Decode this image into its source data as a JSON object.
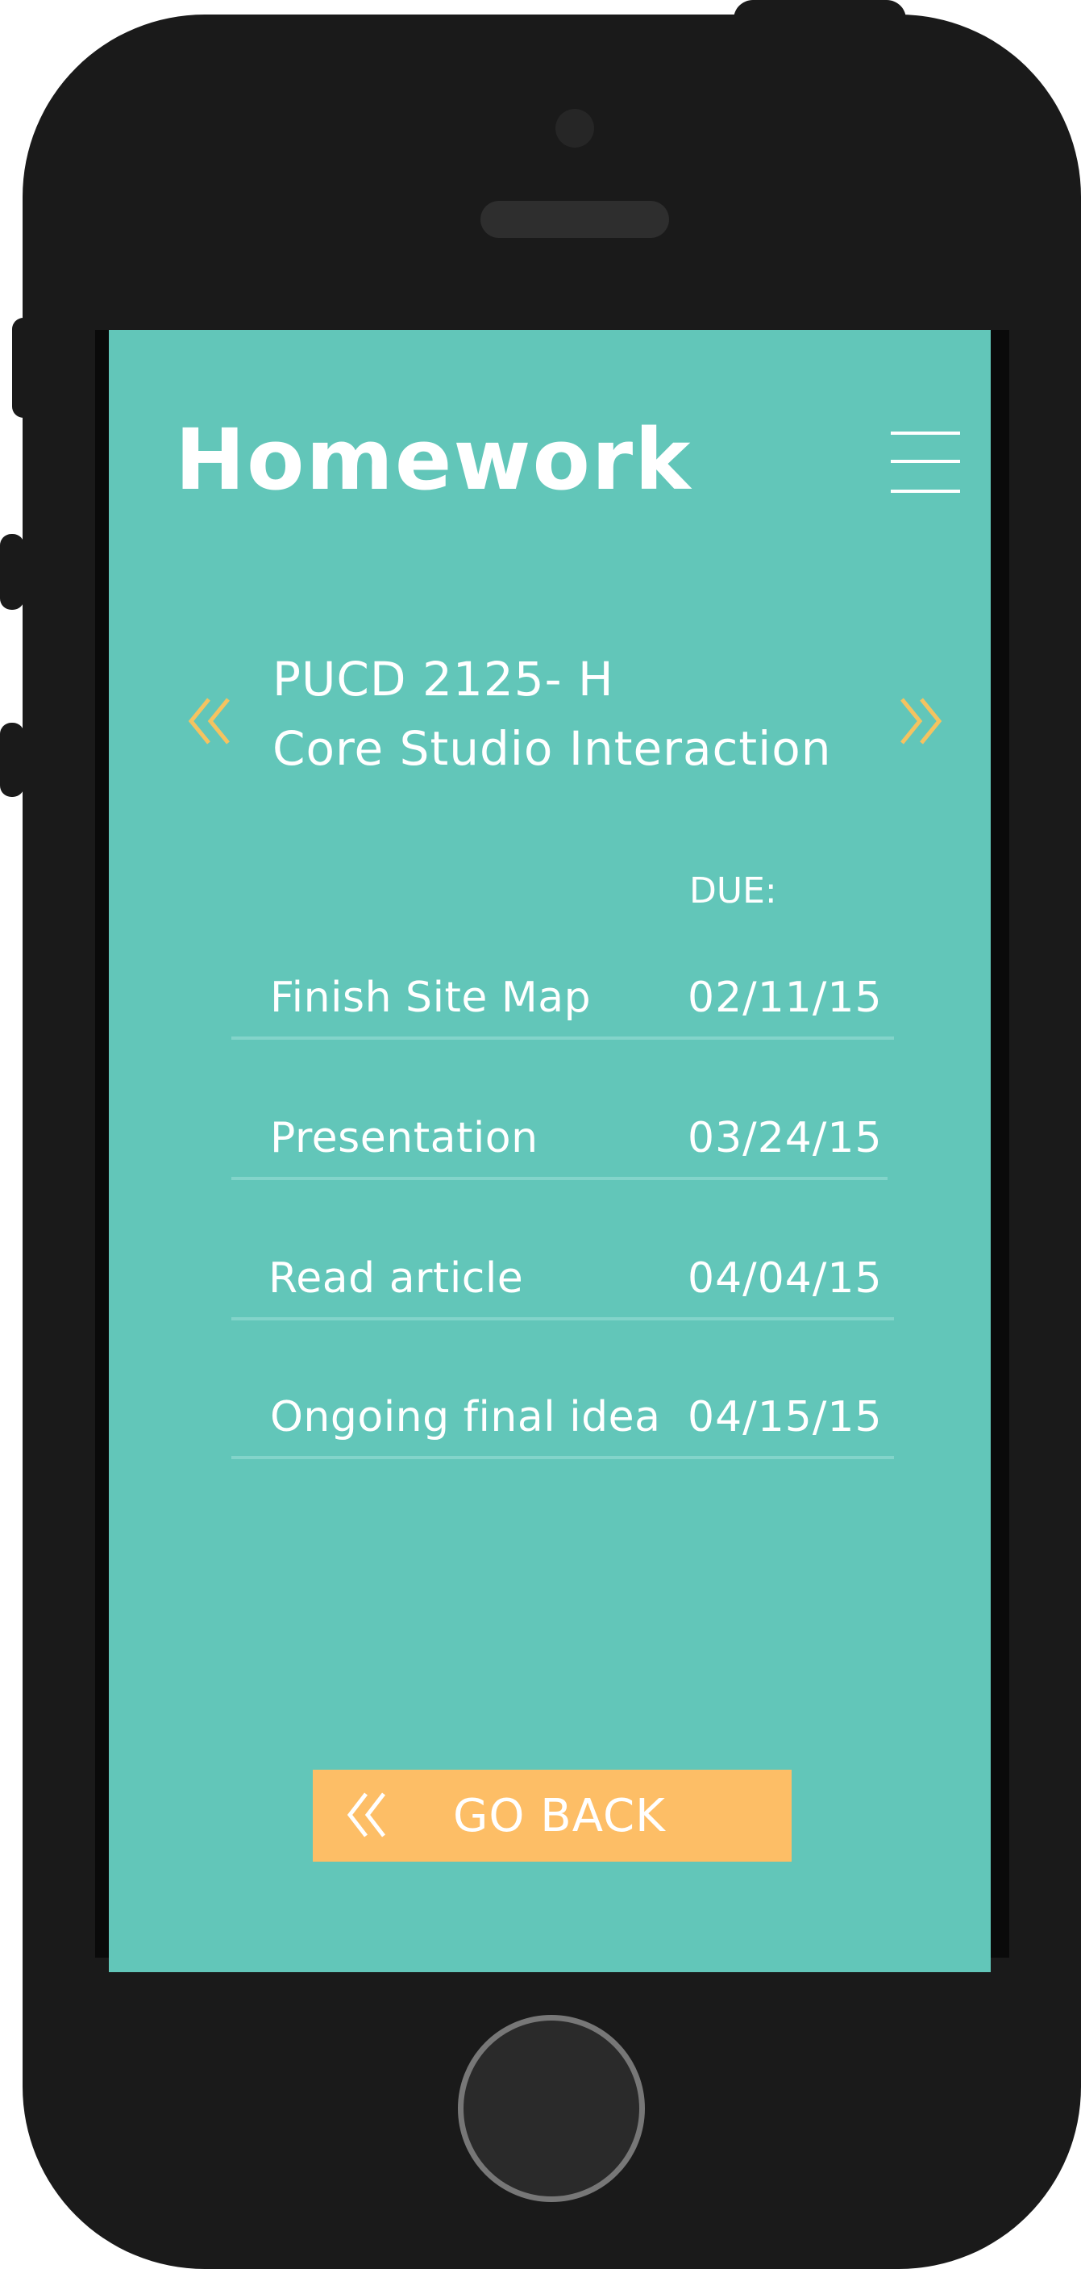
{
  "app": {
    "title": "Homework",
    "menu_icon": "hamburger-menu-icon"
  },
  "course": {
    "code": "PUCD 2125- H",
    "name": "Core Studio Interaction",
    "prev_icon": "double-chevron-left-icon",
    "next_icon": "double-chevron-right-icon"
  },
  "assignments": {
    "due_header": "DUE:",
    "items": [
      {
        "name": "Finish Site Map",
        "due": "02/11/15"
      },
      {
        "name": "Presentation",
        "due": "03/24/15"
      },
      {
        "name": "Read article",
        "due": "04/04/15"
      },
      {
        "name": "Ongoing final idea",
        "due": "04/15/15"
      }
    ]
  },
  "footer": {
    "back_label": "GO BACK",
    "back_icon": "double-chevron-left-icon"
  },
  "colors": {
    "screen_bg": "#62c6b9",
    "accent": "#f5c360",
    "button_bg": "#fdbe66",
    "phone_body": "#1a1a1a",
    "text": "#ffffff"
  }
}
